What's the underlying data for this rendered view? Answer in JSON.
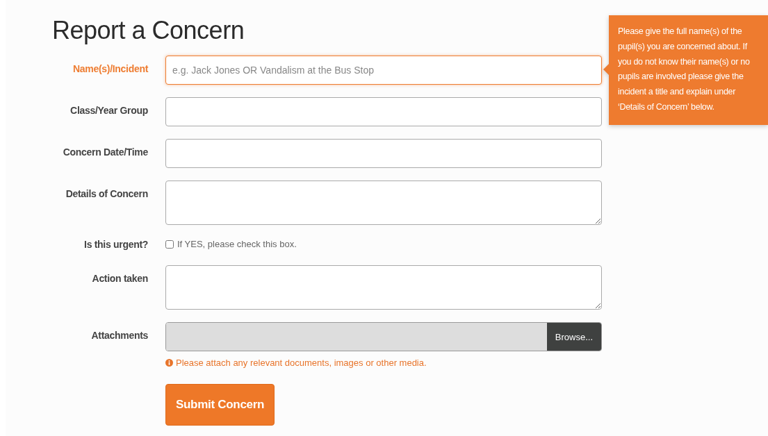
{
  "title": "Report a Concern",
  "fields": [
    {
      "kind": "text",
      "label": "Name(s)/Incident",
      "placeholder": "e.g. Jack Jones OR Vandalism at the Bus Stop",
      "focused": true
    },
    {
      "kind": "text",
      "label": "Class/Year Group",
      "focused": false
    },
    {
      "kind": "text",
      "label": "Concern Date/Time",
      "focused": false
    },
    {
      "kind": "textarea",
      "label": "Details of Concern",
      "focused": false
    },
    {
      "kind": "checkbox",
      "label": "Is this urgent?",
      "text": "If YES, please check this box.",
      "checked": false,
      "focused": false
    },
    {
      "kind": "textarea",
      "label": "Action taken",
      "focused": false
    },
    {
      "kind": "file",
      "label": "Attachments",
      "button": "Browse...",
      "help": "Please attach any relevant documents, images or other media.",
      "focused": false
    }
  ],
  "submit": "Submit Concern",
  "tooltip": "Please give the full name(s) of the pupil(s) you are concerned about. If you do not know their name(s) or no pupils are involved please give the incident a title and explain under ‘Details of Concern’ below."
}
